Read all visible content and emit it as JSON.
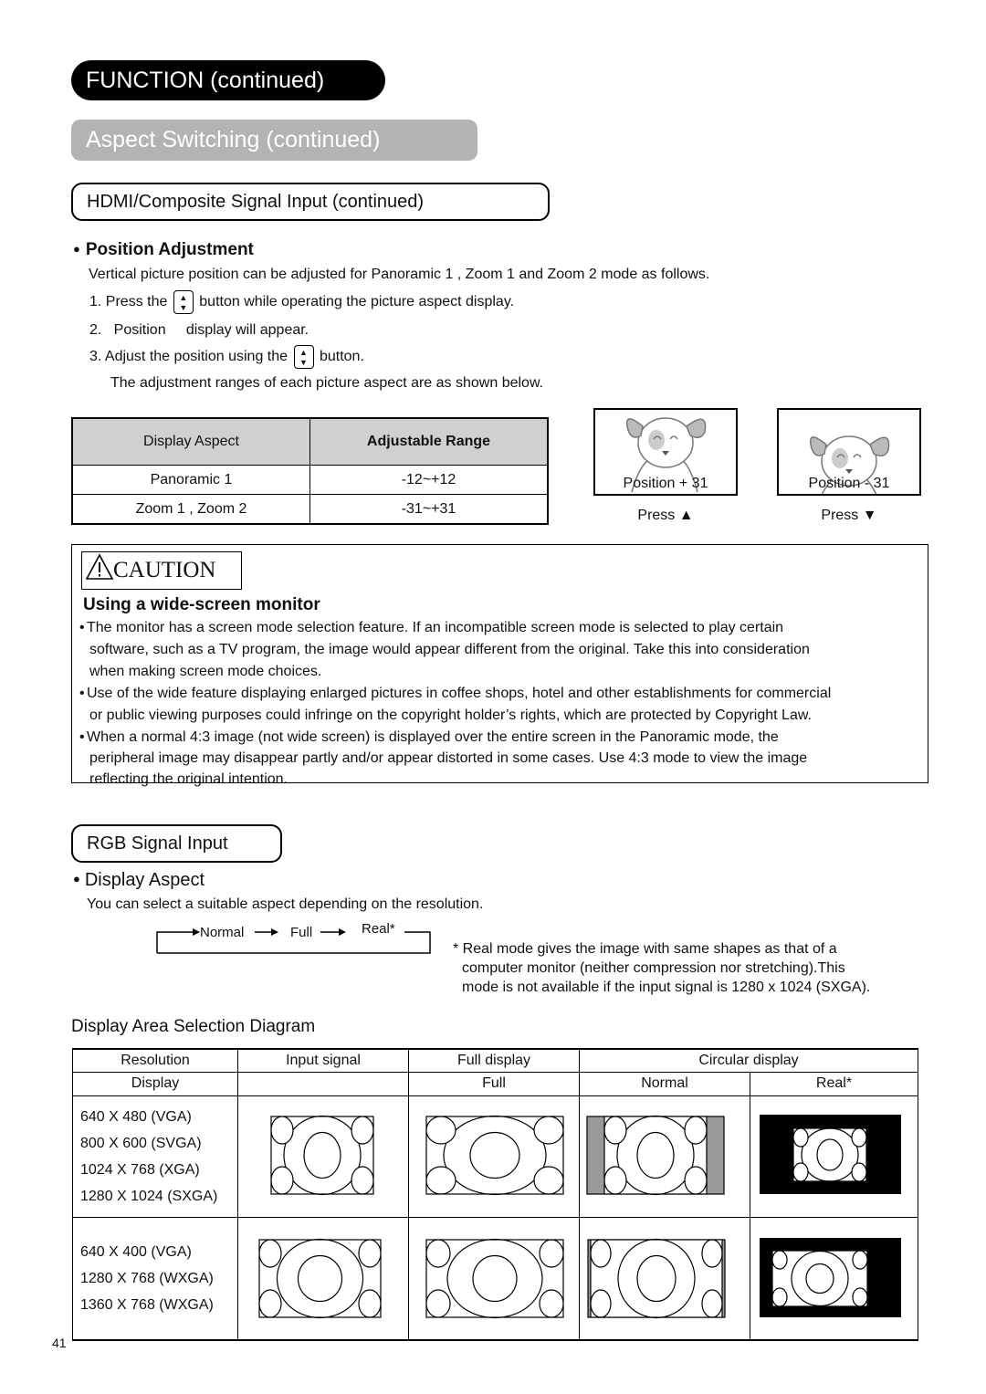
{
  "headers": {
    "function": "FUNCTION (continued)",
    "aspect_switching": "Aspect Switching (continued)",
    "hdmi": "HDMI/Composite Signal Input (continued)",
    "rgb": "RGB Signal Input"
  },
  "position_adjustment": {
    "title": "Position Adjustment",
    "intro": "Vertical picture position can be adjusted for Panoramic 1 , Zoom 1  and Zoom 2  mode as follows.",
    "step1_pre": "1.  Press the",
    "step1_post": "button while operating the picture aspect display.",
    "step2": "2.   Position     display will appear.",
    "step3_pre": "3.  Adjust the position using the",
    "step3_post": "button.",
    "note": "The adjustment ranges of each picture aspect are as shown below.",
    "button_icon": "up-down-arrow-button-icon"
  },
  "range_table": {
    "headers": [
      "Display Aspect",
      "Adjustable Range"
    ],
    "rows": [
      [
        "Panoramic 1",
        "-12~+12"
      ],
      [
        "Zoom 1 , Zoom 2",
        "-31~+31"
      ]
    ]
  },
  "position_examples": [
    {
      "label": "Position  + 31",
      "press": "Press ▲"
    },
    {
      "label": "Position  - 31",
      "press": "Press ▼"
    }
  ],
  "caution": {
    "tag": "CAUTION",
    "title": "Using a wide-screen monitor",
    "bullets": [
      [
        "The monitor has a screen mode selection feature. If an incompatible screen mode is selected to play certain",
        "software, such as a TV program, the image would appear different from the original. Take this into consideration",
        "when making screen mode choices."
      ],
      [
        "Use of the wide feature displaying enlarged pictures in coffee shops, hotel and other establishments for commercial",
        "or public viewing purposes could infringe on the copyright holder’s rights, which are protected by Copyright Law."
      ],
      [
        "When a normal 4:3 image (not wide screen) is displayed over the entire screen in the Panoramic mode, the",
        "peripheral image may disappear partly and/or appear distorted in some cases. Use 4:3 mode to view the image",
        "reflecting the original intention."
      ]
    ]
  },
  "display_aspect": {
    "title": "Display Aspect",
    "desc": "You can select a suitable aspect depending on the resolution.",
    "flow": [
      "Normal",
      "Full",
      "Real*"
    ],
    "footnote": [
      "* Real mode gives the image with same shapes as that of a",
      "computer monitor (neither compression nor stretching).This",
      "mode is not available if the input signal is 1280 x 1024 (SXGA)."
    ]
  },
  "diagram": {
    "title": "Display Area Selection Diagram",
    "header_row1": [
      "Resolution",
      "Input signal",
      "Full display",
      "Circular display"
    ],
    "header_row2": [
      "Display",
      "",
      "Full",
      "Normal",
      "Real*"
    ],
    "rows": [
      {
        "resolutions": [
          "640 X 480 (VGA)",
          "800 X 600 (SVGA)",
          "1024 X 768 (XGA)",
          "1280 X 1024 (SXGA)"
        ]
      },
      {
        "resolutions": [
          "640 X 400 (VGA)",
          "1280 X 768 (WXGA)",
          "1360 X 768 (WXGA)"
        ]
      }
    ]
  },
  "page_number": "41"
}
